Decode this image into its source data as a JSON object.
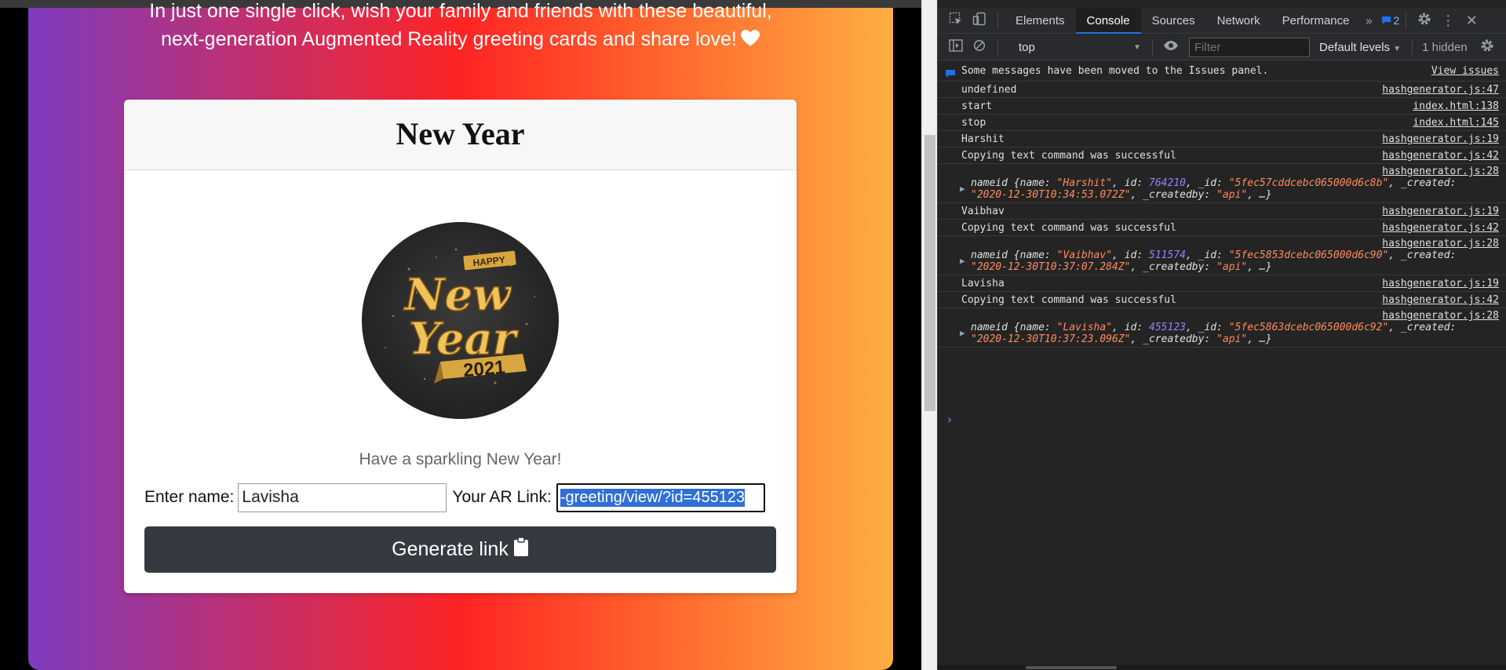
{
  "page": {
    "tagline_line1": "In just one single click, wish your family and friends with these beautiful,",
    "tagline_line2": "next-generation Augmented Reality greeting cards and share love!",
    "card": {
      "title": "New Year",
      "badge": {
        "top": "HAPPY",
        "line1": "New",
        "line2": "Year",
        "year": "2021"
      },
      "wish_text": "Have a sparkling New Year!",
      "name_label": "Enter name:",
      "name_value": "Lavisha",
      "ar_label": "Your AR Link:",
      "ar_link_value": "-greeting/view/?id=455123",
      "generate_label": "Generate link"
    }
  },
  "devtools": {
    "tabs": [
      "Elements",
      "Console",
      "Sources",
      "Network",
      "Performance"
    ],
    "active_tab": "Console",
    "issues_count": "2",
    "context": "top",
    "filter_placeholder": "Filter",
    "levels": "Default levels",
    "hidden": "1 hidden",
    "info_message": "Some messages have been moved to the Issues panel.",
    "view_issues": "View issues",
    "logs": [
      {
        "text": "undefined",
        "src": "hashgenerator.js:47"
      },
      {
        "text": "start",
        "src": "index.html:138"
      },
      {
        "text": "stop",
        "src": "index.html:145"
      },
      {
        "text": "Harshit",
        "src": "hashgenerator.js:19"
      },
      {
        "text": "Copying text command was successful",
        "src": "hashgenerator.js:42"
      },
      {
        "src": "hashgenerator.js:28",
        "name": "\"Harshit\"",
        "id": "764210",
        "_id": "\"5fec57cddcebc065000d6c8b\"",
        "created": "\"2020-12-30T10:34:53.072Z\"",
        "createdby": "\"api\""
      },
      {
        "text": "Vaibhav",
        "src": "hashgenerator.js:19"
      },
      {
        "text": "Copying text command was successful",
        "src": "hashgenerator.js:42"
      },
      {
        "src": "hashgenerator.js:28",
        "name": "\"Vaibhav\"",
        "id": "511574",
        "_id": "\"5fec5853dcebc065000d6c90\"",
        "created": "\"2020-12-30T10:37:07.284Z\"",
        "createdby": "\"api\""
      },
      {
        "text": "Lavisha",
        "src": "hashgenerator.js:19"
      },
      {
        "text": "Copying text command was successful",
        "src": "hashgenerator.js:42"
      },
      {
        "src": "hashgenerator.js:28",
        "name": "\"Lavisha\"",
        "id": "455123",
        "_id": "\"5fec5863dcebc065000d6c92\"",
        "created": "\"2020-12-30T10:37:23.096Z\"",
        "createdby": "\"api\""
      }
    ],
    "obj_label": "nameid",
    "prompt": "›"
  }
}
